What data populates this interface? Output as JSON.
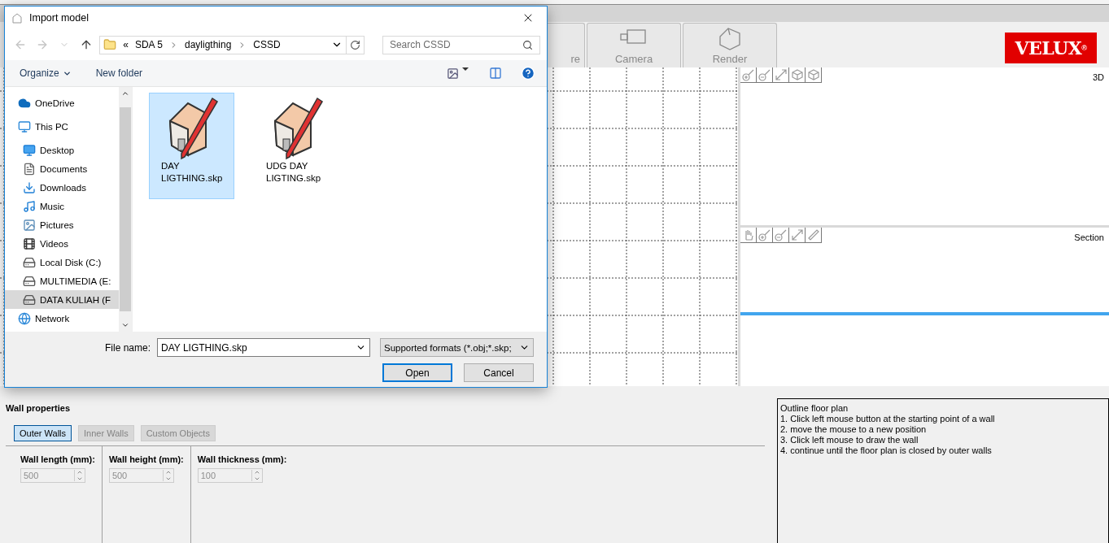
{
  "app": {
    "tabs": [
      {
        "label": "re",
        "selected": false
      },
      {
        "label": "Camera",
        "selected": false
      },
      {
        "label": "Render",
        "selected": false
      }
    ],
    "logo": {
      "text": "VELUX",
      "mark": "®"
    },
    "views": [
      {
        "label": "3D"
      },
      {
        "label": "Section"
      }
    ],
    "wall_properties": {
      "title": "Wall properties",
      "tabs": [
        {
          "label": "Outer Walls",
          "selected": true,
          "disabled": false
        },
        {
          "label": "Inner Walls",
          "selected": false,
          "disabled": true
        },
        {
          "label": "Custom Objects",
          "selected": false,
          "disabled": true
        }
      ],
      "fields": [
        {
          "label": "Wall length (mm):",
          "value": "500",
          "disabled": true
        },
        {
          "label": "Wall height (mm):",
          "value": "500",
          "disabled": true
        },
        {
          "label": "Wall thickness (mm):",
          "value": "100",
          "disabled": true
        }
      ]
    },
    "instructions": [
      "Outline floor plan",
      "1. Click left mouse button at the starting point of a wall",
      "2. move the mouse to a new position",
      "3. Click left mouse to draw the wall",
      "4. continue until the floor plan is closed by outer walls"
    ]
  },
  "dialog": {
    "title": "Import model",
    "path": [
      "SDA 5",
      "dayligthing",
      "CSSD"
    ],
    "path_overflow": "«",
    "search": {
      "placeholder": "Search CSSD"
    },
    "toolbar": {
      "organize": "Organize",
      "new_folder": "New folder"
    },
    "nav": [
      {
        "label": "OneDrive",
        "kind": "cloud",
        "selected": false
      },
      {
        "label": "This PC",
        "kind": "pc",
        "selected": false,
        "children": [
          {
            "label": "Desktop",
            "kind": "desktop",
            "selected": false
          },
          {
            "label": "Documents",
            "kind": "documents",
            "selected": false
          },
          {
            "label": "Downloads",
            "kind": "downloads",
            "selected": false
          },
          {
            "label": "Music",
            "kind": "music",
            "selected": false
          },
          {
            "label": "Pictures",
            "kind": "pictures",
            "selected": false
          },
          {
            "label": "Videos",
            "kind": "videos",
            "selected": false
          },
          {
            "label": "Local Disk (C:)",
            "kind": "drive",
            "selected": false
          },
          {
            "label": "MULTIMEDIA (E:",
            "kind": "drive",
            "selected": false
          },
          {
            "label": "DATA KULIAH (F",
            "kind": "drive",
            "selected": true
          }
        ]
      },
      {
        "label": "Network",
        "kind": "network",
        "selected": false
      }
    ],
    "files": [
      {
        "name": "DAY LIGTHING.skp",
        "selected": true
      },
      {
        "name": "UDG DAY LIGTING.skp",
        "selected": false
      }
    ],
    "file_name": {
      "label": "File name:",
      "value": "DAY LIGTHING.skp"
    },
    "filter": "Supported formats (*.obj;*.skp;",
    "buttons": [
      {
        "label": "Open",
        "default": true
      },
      {
        "label": "Cancel",
        "default": false
      }
    ]
  }
}
